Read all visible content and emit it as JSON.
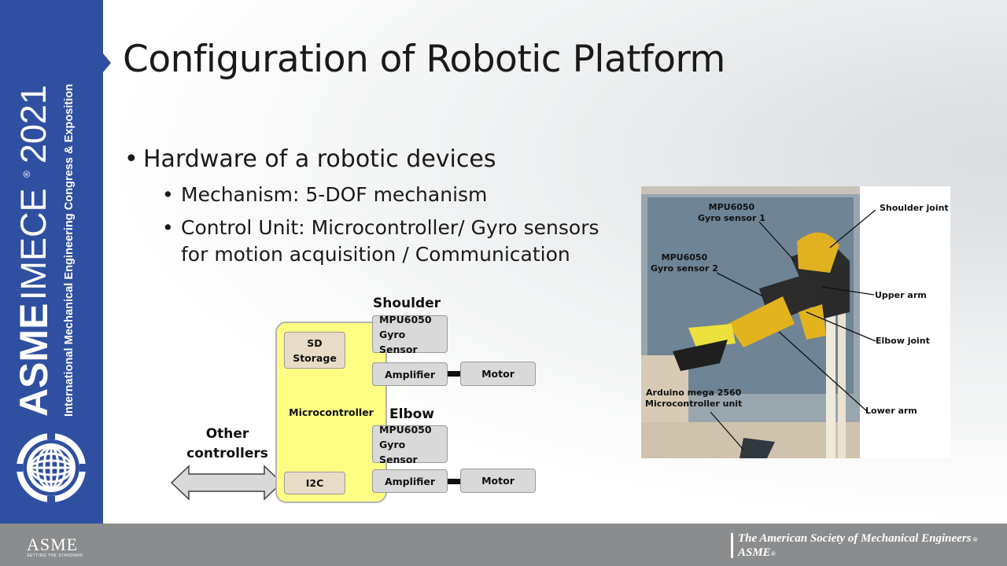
{
  "slide": {
    "title": "Configuration of Robotic Platform",
    "bullets": {
      "l1": "Hardware of a robotic devices",
      "l2a": "Mechanism: 5-DOF mechanism",
      "l2b_line1": "Control Unit: Microcontroller/ Gyro sensors",
      "l2b_line2": "for motion acquisition / Communication"
    }
  },
  "sidebar": {
    "brand": "ASME",
    "event": "IMECE",
    "year": "2021",
    "subtitle": "International Mechanical Engineering Congress & Exposition"
  },
  "diagram": {
    "shoulder_label": "Shoulder",
    "elbow_label": "Elbow",
    "other_controllers_line1": "Other",
    "other_controllers_line2": "controllers",
    "microcontroller": "Microcontroller",
    "sd_storage_line1": "SD",
    "sd_storage_line2": "Storage",
    "i2c": "I2C",
    "mpu_line1": "MPU6050",
    "mpu_line2": "Gyro Sensor",
    "amplifier": "Amplifier",
    "motor": "Motor"
  },
  "photo": {
    "labels": {
      "mpu1_line1": "MPU6050",
      "mpu1_line2": "Gyro sensor 1",
      "mpu2_line1": "MPU6050",
      "mpu2_line2": "Gyro sensor 2",
      "shoulder_joint": "Shoulder joint",
      "upper_arm": "Upper arm",
      "elbow_joint": "Elbow joint",
      "lower_arm": "Lower arm",
      "arduino_line1": "Arduino mega 2560",
      "arduino_line2": "Microcontroller unit"
    }
  },
  "footer": {
    "logo_text": "ASME",
    "logo_tagline": "SETTING THE STANDARD",
    "org_line1": "The American Society of Mechanical Engineers",
    "org_line2": "ASME"
  },
  "colors": {
    "sidebar_blue": "#2f4fa1",
    "footer_gray": "#8a8c8e",
    "microcontroller_yellow": "#fdfd84",
    "tan_box": "#e8dcc6"
  }
}
